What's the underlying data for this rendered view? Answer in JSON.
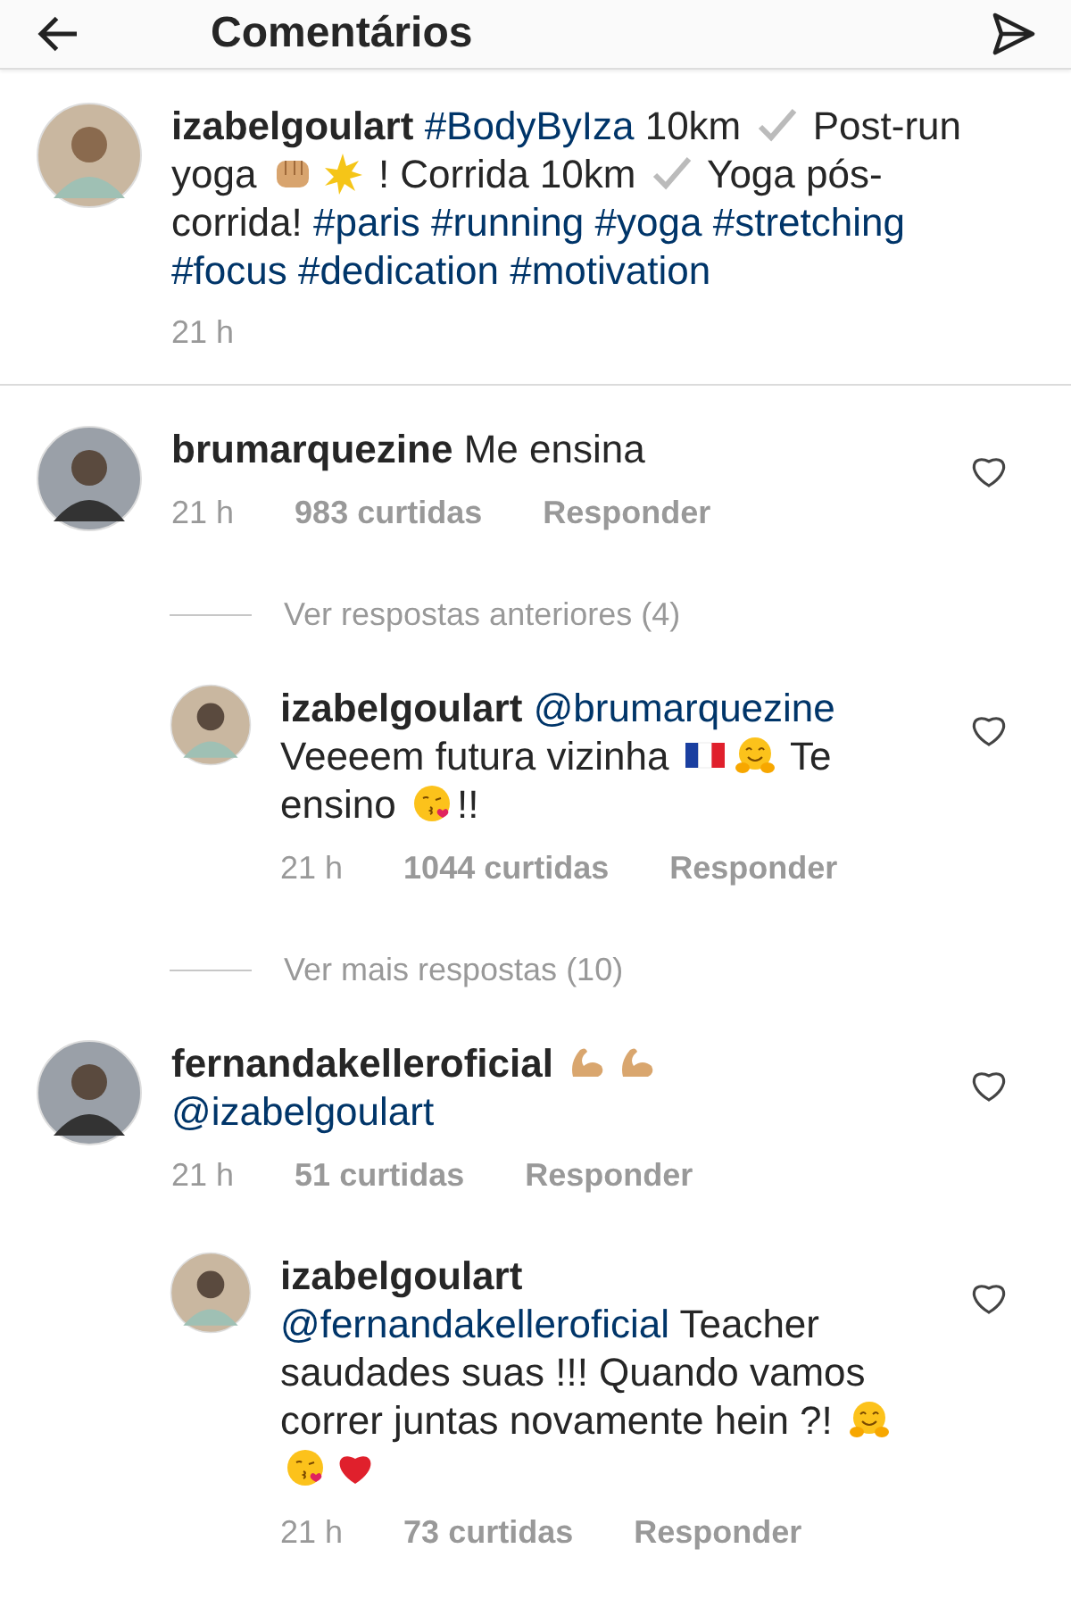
{
  "header": {
    "title": "Comentários"
  },
  "caption": {
    "user": "izabelgoulart",
    "segments": [
      {
        "kind": "tag",
        "text": "#BodyByIza"
      },
      {
        "kind": "text",
        "text": " 10km "
      },
      {
        "kind": "check"
      },
      {
        "kind": "text",
        "text": " Post-run yoga "
      },
      {
        "kind": "fist"
      },
      {
        "kind": "burst"
      },
      {
        "kind": "text",
        "text": " ! Corrida 10km "
      },
      {
        "kind": "check"
      },
      {
        "kind": "text",
        "text": " Yoga pós-corrida!"
      },
      {
        "kind": "tag",
        "text": "#paris"
      },
      {
        "kind": "tag",
        "text": "#running"
      },
      {
        "kind": "tag",
        "text": "#yoga"
      },
      {
        "kind": "tag",
        "text": "#stretching"
      },
      {
        "kind": "tag",
        "text": "#focus"
      },
      {
        "kind": "tag",
        "text": "#dedication"
      },
      {
        "kind": "tag",
        "text": "#motivation"
      }
    ],
    "time": "21 h"
  },
  "thread": [
    {
      "kind": "comment",
      "user": "brumarquezine",
      "segments": [
        {
          "kind": "text",
          "text": " Me ensina"
        }
      ],
      "time": "21 h",
      "likes": "983 curtidas",
      "reply": "Responder",
      "liked": false
    },
    {
      "kind": "more",
      "text": "Ver respostas anteriores (4)"
    },
    {
      "kind": "reply",
      "user": "izabelgoulart",
      "segments": [
        {
          "kind": "tag",
          "text": "@brumarquezine"
        },
        {
          "kind": "text",
          "text": " Veeeem futura vizinha "
        },
        {
          "kind": "flag"
        },
        {
          "kind": "hug"
        },
        {
          "kind": "text",
          "text": " Te ensino "
        },
        {
          "kind": "kiss"
        },
        {
          "kind": "text",
          "text": "!!"
        }
      ],
      "time": "21 h",
      "likes": "1044 curtidas",
      "reply": "Responder",
      "liked": false
    },
    {
      "kind": "more",
      "text": "Ver mais respostas (10)"
    },
    {
      "kind": "comment",
      "user": "fernandakelleroficial",
      "segments": [
        {
          "kind": "muscle"
        },
        {
          "kind": "muscle"
        },
        {
          "kind": "break"
        },
        {
          "kind": "tag",
          "text": "@izabelgoulart"
        }
      ],
      "time": "21 h",
      "likes": "51 curtidas",
      "reply": "Responder",
      "liked": false
    },
    {
      "kind": "reply",
      "user": "izabelgoulart",
      "segments": [
        {
          "kind": "break"
        },
        {
          "kind": "tag",
          "text": "@fernandakelleroficial"
        },
        {
          "kind": "text",
          "text": " Teacher saudades suas !!! Quando vamos correr juntas novamente hein ?! "
        },
        {
          "kind": "hug"
        },
        {
          "kind": "kiss"
        },
        {
          "kind": "heart"
        }
      ],
      "time": "21 h",
      "likes": "73 curtidas",
      "reply": "Responder",
      "liked": false
    }
  ]
}
